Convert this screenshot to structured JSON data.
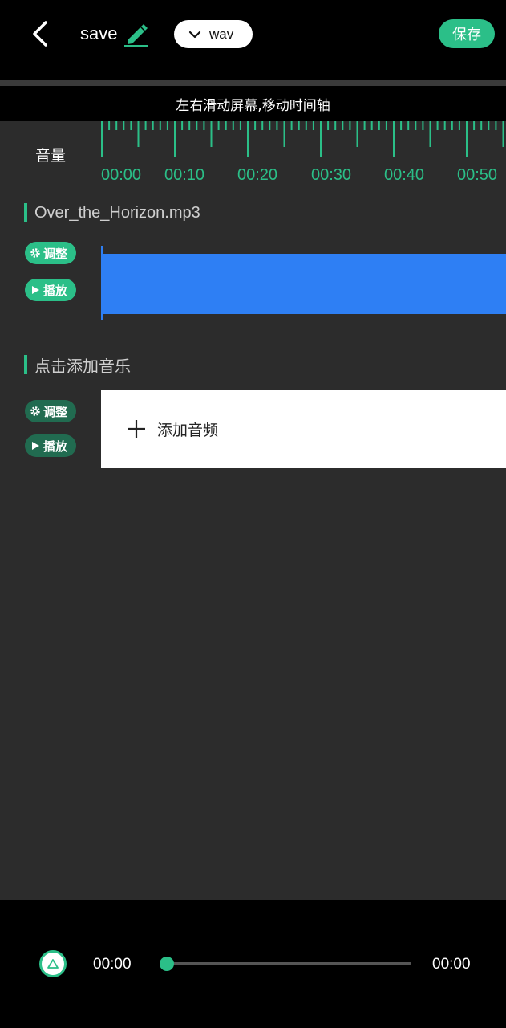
{
  "header": {
    "back_icon": "chevron-left-icon",
    "title": "save",
    "edit_icon": "pencil-icon",
    "format": "wav",
    "format_icon": "chevron-down-icon",
    "save_label": "保存"
  },
  "hint": "左右滑动屏幕,移动时间轴",
  "timeline": {
    "volume_label": "音量",
    "labels": [
      "00:00",
      "00:10",
      "00:20",
      "00:30",
      "00:40",
      "00:50"
    ]
  },
  "tracks": [
    {
      "title": "Over_the_Horizon.mp3",
      "adjust_label": "调整",
      "play_label": "播放"
    },
    {
      "title": "点击添加音乐",
      "adjust_label": "调整",
      "play_label": "播放",
      "add_label": "添加音频"
    }
  ],
  "player": {
    "current_time": "00:00",
    "total_time": "00:00",
    "progress": 0
  },
  "colors": {
    "accent": "#2bbf88",
    "accent_dim": "#216b50",
    "waveform": "#2e7ff4",
    "panel": "#2c2c2c"
  }
}
